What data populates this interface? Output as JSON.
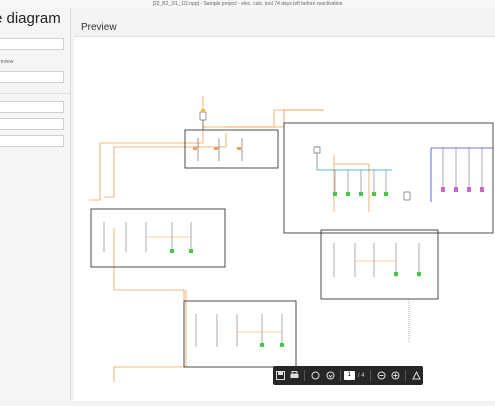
{
  "window": {
    "title": "[22_B2_2/1_1/2.npp] - Sample project - elec. calc. tool 74 days left before reactivation"
  },
  "left_panel": {
    "title": "e diagram",
    "labels": [
      "review"
    ]
  },
  "preview": {
    "title": "Preview"
  },
  "toolbar": {
    "page_current": "1",
    "page_total": "/ 4",
    "icons": [
      "save-icon",
      "print-icon",
      "rotate-left-icon",
      "rotate-right-icon",
      "zoom-out-icon",
      "zoom-in-icon",
      "pdf-icon",
      "fullscreen-icon"
    ]
  },
  "colors": {
    "orange_wire": "#f0a050",
    "blue_wire": "#4040e0",
    "teal_bus": "#22aaaa",
    "green_component": "#44cc44"
  }
}
